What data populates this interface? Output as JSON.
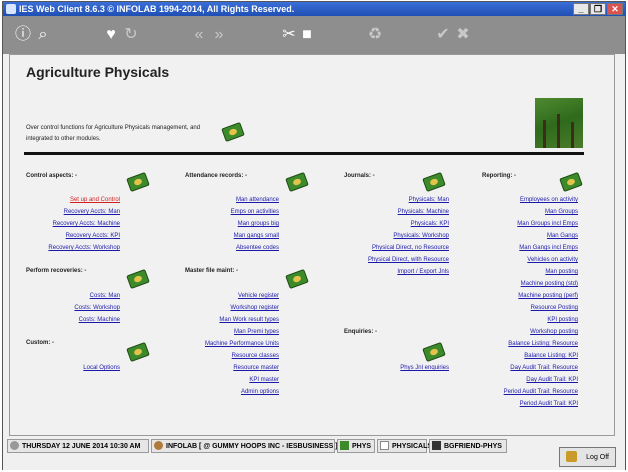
{
  "window": {
    "title": "IES Web Client 8.6.3 © INFOLAB 1994-2014, All Rights Reserved.",
    "buttons": {
      "minimize": "_",
      "restore": "❐",
      "close": "✕"
    }
  },
  "toolbar": {
    "icons": [
      "info-icon",
      "search-icon",
      "heart-icon",
      "refresh-icon",
      "back-icon",
      "forward-icon",
      "tools-icon",
      "stop-icon",
      "recycle-icon",
      "ok-icon",
      "cancel-icon"
    ]
  },
  "page": {
    "title": "Agriculture Physicals",
    "description": "Over control functions for Agriculture Physicals management, and integrated to other modules."
  },
  "sections": {
    "control": {
      "title": "Control aspects: -",
      "links": [
        "Set up and Control",
        "Recovery Accts: Man",
        "Recovery Accts: Machine",
        "Recovery Accts: KPI",
        "Recovery Accts: Workshop"
      ]
    },
    "perform": {
      "title": "Perform recoveries: -",
      "links": [
        "Costs: Man",
        "Costs: Workshop",
        "Costs: Machine"
      ]
    },
    "custom": {
      "title": "Custom: -",
      "links": [
        "Local Options"
      ]
    },
    "attendance": {
      "title": "Attendance records: -",
      "links": [
        "Man attendance",
        "Emps on activities",
        "Man groups big",
        "Man gangs small",
        "Absentee codes"
      ]
    },
    "master": {
      "title": "Master file maint: -",
      "links": [
        "Vehicle register",
        "Workshop register",
        "Man Work result types",
        "Man Premi types",
        "Machine Performance Units",
        "Resource classes",
        "Resource master",
        "KPI master",
        "Admin options"
      ]
    },
    "journals": {
      "title": "Journals: -",
      "links": [
        "Physicals: Man",
        "Physicals: Machine",
        "Physicals: KPI",
        "Physicals: Workshop",
        "Physical Direct, no Resource",
        "Physical Direct, with Resource",
        "Import / Export Jnls"
      ]
    },
    "enquiries": {
      "title": "Enquiries: -",
      "links": [
        "Phys Jnl enquiries"
      ]
    },
    "reporting": {
      "title": "Reporting: -",
      "links": [
        "Employees on activity",
        "Man Groups",
        "Man Groups incl Emps",
        "Man Gangs",
        "Man Gangs incl Emps",
        "Vehicles on activity",
        "Man posting",
        "Machine posting (std)",
        "Machine posting (perf)",
        "Resource Posting",
        "KPI posting",
        "Workshop posting",
        "Balance Listing: Resource",
        "Balance Listing: KPI",
        "Day Audit Trail: Resource",
        "Day Audit Trail: KPI",
        "Period Audit Trail: Resource",
        "Period Audit Trail: KPI"
      ]
    }
  },
  "statusbar": {
    "date": "THURSDAY 12 JUNE 2014 10:30 AM",
    "company": "INFOLAB [ @ GUMMY HOOPS INC - IESBUSINESS ]",
    "tabs": [
      "PHYS",
      "PHYSICALS",
      "BGFRIEND-PHYS"
    ],
    "logoff": "Log Off"
  },
  "colors": {
    "titlebar": "#1f4fb3",
    "toolbar": "#8e8e8e",
    "link": "#1a1aaa",
    "active_link": "#d02020"
  }
}
